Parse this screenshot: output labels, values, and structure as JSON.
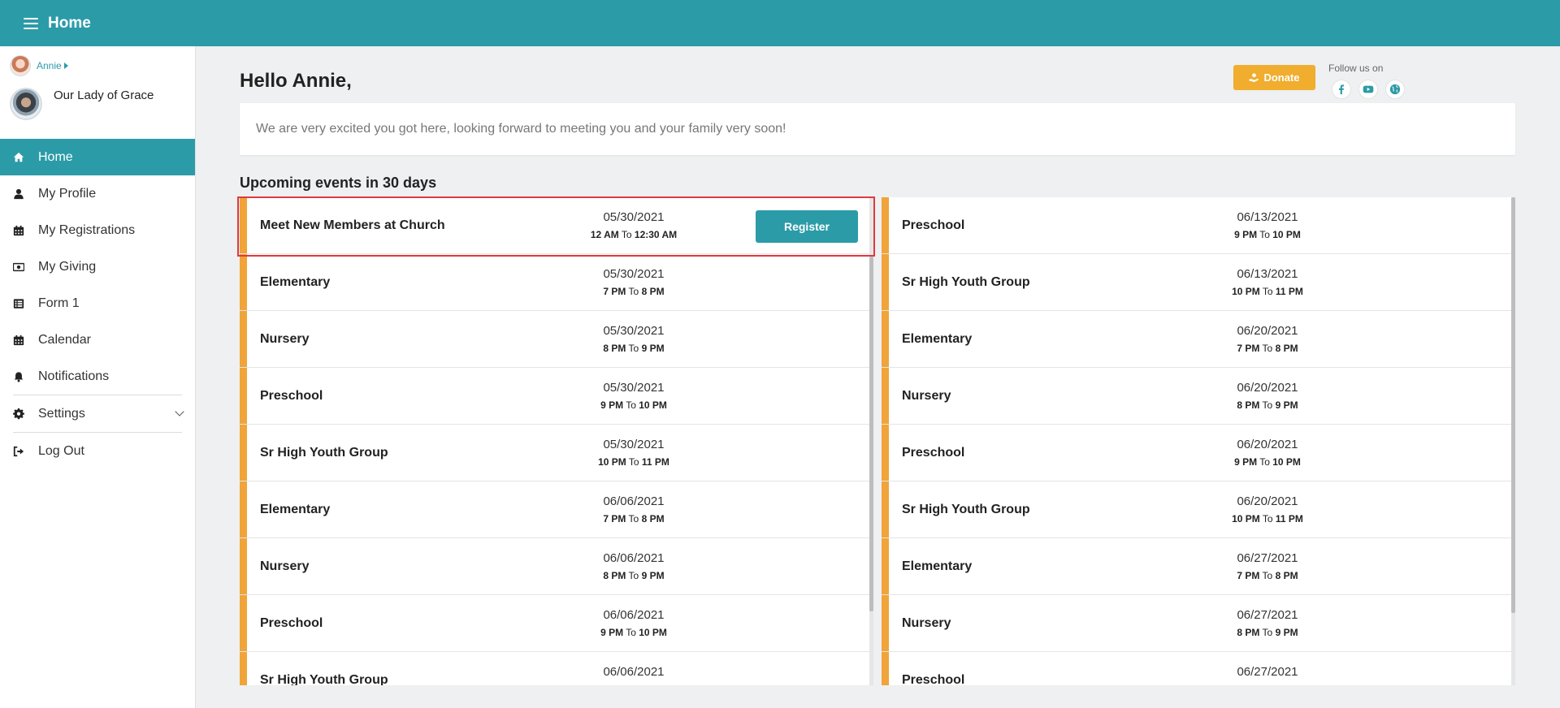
{
  "header": {
    "title": "Home",
    "menu_icon": "hamburger-icon"
  },
  "sidebar": {
    "user_name": "Annie",
    "church_name": "Our Lady of Grace",
    "items": [
      {
        "label": "Home",
        "icon": "home-icon",
        "active": true
      },
      {
        "label": "My Profile",
        "icon": "user-icon"
      },
      {
        "label": "My Registrations",
        "icon": "calendar-icon"
      },
      {
        "label": "My Giving",
        "icon": "money-icon"
      },
      {
        "label": "Form 1",
        "icon": "list-icon"
      },
      {
        "label": "Calendar",
        "icon": "calendar-icon"
      },
      {
        "label": "Notifications",
        "icon": "bell-icon"
      },
      {
        "label": "Settings",
        "icon": "gear-icon",
        "has_submenu": true
      },
      {
        "label": "Log Out",
        "icon": "logout-icon"
      }
    ]
  },
  "main": {
    "greeting": "Hello Annie,",
    "donate_label": "Donate",
    "follow_label": "Follow us on",
    "social": [
      "facebook-icon",
      "youtube-icon",
      "globe-icon"
    ],
    "welcome_message": "We are very excited you got here, looking forward to meeting you and your family very soon!",
    "events_title": "Upcoming events in 30 days",
    "to_word": "To",
    "register_label": "Register",
    "accent_color": "#f0a43a",
    "brand_color": "#2b9ba8",
    "left_events": [
      {
        "name": "Meet New Members at Church",
        "date": "05/30/2021",
        "start": "12 AM",
        "end": "12:30 AM",
        "register": true
      },
      {
        "name": "Elementary",
        "date": "05/30/2021",
        "start": "7 PM",
        "end": "8 PM"
      },
      {
        "name": "Nursery",
        "date": "05/30/2021",
        "start": "8 PM",
        "end": "9 PM"
      },
      {
        "name": "Preschool",
        "date": "05/30/2021",
        "start": "9 PM",
        "end": "10 PM"
      },
      {
        "name": "Sr High Youth Group",
        "date": "05/30/2021",
        "start": "10 PM",
        "end": "11 PM"
      },
      {
        "name": "Elementary",
        "date": "06/06/2021",
        "start": "7 PM",
        "end": "8 PM"
      },
      {
        "name": "Nursery",
        "date": "06/06/2021",
        "start": "8 PM",
        "end": "9 PM"
      },
      {
        "name": "Preschool",
        "date": "06/06/2021",
        "start": "9 PM",
        "end": "10 PM"
      },
      {
        "name": "Sr High Youth Group",
        "date": "06/06/2021",
        "start": "",
        "end": ""
      }
    ],
    "right_events": [
      {
        "name": "Preschool",
        "date": "06/13/2021",
        "start": "9 PM",
        "end": "10 PM"
      },
      {
        "name": "Sr High Youth Group",
        "date": "06/13/2021",
        "start": "10 PM",
        "end": "11 PM"
      },
      {
        "name": "Elementary",
        "date": "06/20/2021",
        "start": "7 PM",
        "end": "8 PM"
      },
      {
        "name": "Nursery",
        "date": "06/20/2021",
        "start": "8 PM",
        "end": "9 PM"
      },
      {
        "name": "Preschool",
        "date": "06/20/2021",
        "start": "9 PM",
        "end": "10 PM"
      },
      {
        "name": "Sr High Youth Group",
        "date": "06/20/2021",
        "start": "10 PM",
        "end": "11 PM"
      },
      {
        "name": "Elementary",
        "date": "06/27/2021",
        "start": "7 PM",
        "end": "8 PM"
      },
      {
        "name": "Nursery",
        "date": "06/27/2021",
        "start": "8 PM",
        "end": "9 PM"
      },
      {
        "name": "Preschool",
        "date": "06/27/2021",
        "start": "",
        "end": ""
      }
    ]
  }
}
